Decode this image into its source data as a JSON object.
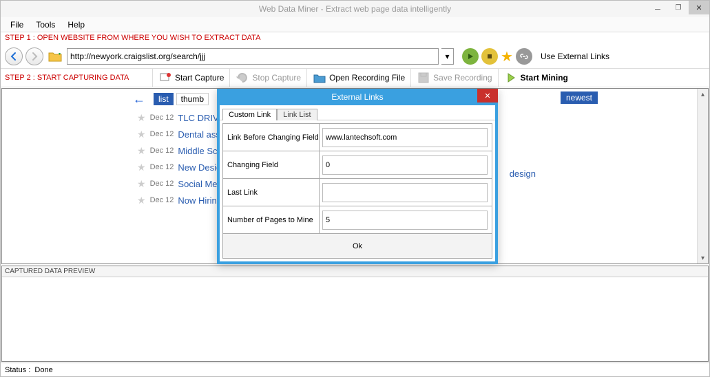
{
  "window": {
    "title": "Web Data Miner -  Extract web page data intelligently"
  },
  "menu": {
    "file": "File",
    "tools": "Tools",
    "help": "Help"
  },
  "step1": "STEP 1 : OPEN WEBSITE FROM WHERE YOU WISH TO EXTRACT DATA",
  "step2": "STEP 2 : START CAPTURING DATA",
  "url": "http://newyork.craigslist.org/search/jjj",
  "toolbar": {
    "externalLinks": "Use External Links",
    "startCapture": "Start Capture",
    "stopCapture": "Stop Capture",
    "openRec": "Open Recording File",
    "saveRec": "Save Recording",
    "startMining": "Start Mining"
  },
  "listing": {
    "views": {
      "list": "list",
      "thumb": "thumb"
    },
    "newest": "newest",
    "designTag": "design",
    "rows": [
      {
        "date": "Dec 12",
        "title": "TLC DRIVE"
      },
      {
        "date": "Dec 12",
        "title": "Dental assista"
      },
      {
        "date": "Dec 12",
        "title": "Middle Schoo"
      },
      {
        "date": "Dec 12",
        "title": "New Designe"
      },
      {
        "date": "Dec 12",
        "title": "Social Media"
      },
      {
        "date": "Dec 12",
        "title": "Now Hiring I"
      }
    ]
  },
  "preview": {
    "hdr": "CAPTURED DATA PREVIEW"
  },
  "status": {
    "label": "Status :",
    "value": "Done"
  },
  "dialog": {
    "title": "External Links",
    "tabs": {
      "custom": "Custom Link",
      "linklist": "Link List"
    },
    "fields": {
      "linkBefore": {
        "label": "Link Before Changing Field",
        "value": "www.lantechsoft.com"
      },
      "changing": {
        "label": "Changing Field",
        "value": "0"
      },
      "lastLink": {
        "label": "Last Link",
        "value": ""
      },
      "numPages": {
        "label": "Number of Pages to Mine",
        "value": "5"
      }
    },
    "ok": "Ok"
  }
}
